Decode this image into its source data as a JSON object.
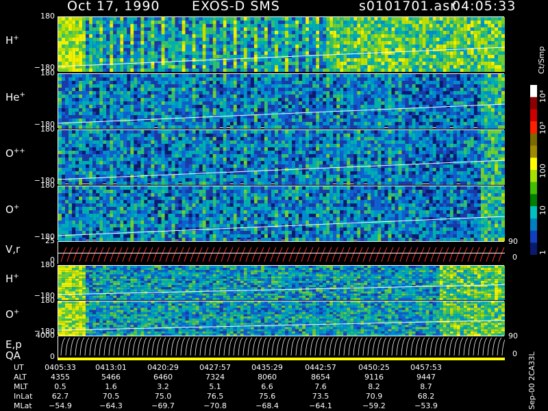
{
  "header": {
    "date": "Oct 17, 1990",
    "instrument": "EXOS-D SMS",
    "file": "s0101701.asr",
    "time": "04:05:33"
  },
  "panels": [
    {
      "id": "h-plus-1",
      "label": "H",
      "sup": "+",
      "top_tick": "180",
      "bottom_tick": "−180"
    },
    {
      "id": "he-plus",
      "label": "He",
      "sup": "+",
      "top_tick": "180",
      "bottom_tick": "−180"
    },
    {
      "id": "o-plus-plus",
      "label": "O",
      "sup": "++",
      "top_tick": "180",
      "bottom_tick": "−180"
    },
    {
      "id": "o-plus-1",
      "label": "O",
      "sup": "+",
      "top_tick": "180",
      "bottom_tick": "−180"
    },
    {
      "id": "vr",
      "label": "V,r",
      "sup": "",
      "top_tick": "25",
      "bottom_tick": "0",
      "right_top": "90",
      "right_bottom": "0"
    },
    {
      "id": "h-plus-2",
      "label": "H",
      "sup": "+",
      "top_tick": "180",
      "bottom_tick": "−180"
    },
    {
      "id": "o-plus-2",
      "label": "O",
      "sup": "+",
      "top_tick": "180",
      "bottom_tick": "−180"
    },
    {
      "id": "ep-qa",
      "label": "E,p",
      "label2": "QA",
      "sup": "",
      "top_tick": "4000",
      "bottom_tick": "0",
      "right_top": "90",
      "right_bottom": "0"
    }
  ],
  "colorbar": {
    "unit": "Ct/Smp",
    "labels": [
      "10⁴",
      "10³",
      "100",
      "10",
      "1"
    ],
    "colors": [
      "#ffffff",
      "#8b0000",
      "#cc0000",
      "#ff2000",
      "#7a6a00",
      "#a08a00",
      "#ffff00",
      "#a8e000",
      "#40c000",
      "#008000",
      "#00c0c0",
      "#0080c0",
      "#1040c0",
      "#0a1a6e"
    ]
  },
  "chart_data": {
    "type": "heatmap",
    "x_axis": {
      "label": "UT",
      "ticks": [
        "0405:33",
        "0413:01",
        "0420:29",
        "0427:57",
        "0435:29",
        "0442:57",
        "0450:25",
        "0457:53"
      ]
    },
    "rows": [
      {
        "name": "UT",
        "values": [
          "0405:33",
          "0413:01",
          "0420:29",
          "0427:57",
          "0435:29",
          "0442:57",
          "0450:25",
          "0457:53"
        ]
      },
      {
        "name": "ALT",
        "values": [
          "4355",
          "5466",
          "6460",
          "7324",
          "8060",
          "8654",
          "9116",
          "9447"
        ]
      },
      {
        "name": "MLT",
        "values": [
          "0.5",
          "1.6",
          "3.2",
          "5.1",
          "6.6",
          "7.6",
          "8.2",
          "8.7"
        ]
      },
      {
        "name": "InLat",
        "values": [
          "62.7",
          "70.5",
          "75.0",
          "76.5",
          "75.6",
          "73.5",
          "70.9",
          "68.2"
        ]
      },
      {
        "name": "MLat",
        "values": [
          "−54.9",
          "−64.3",
          "−69.7",
          "−70.8",
          "−68.4",
          "−64.1",
          "−59.2",
          "−53.9"
        ]
      }
    ],
    "y_range": [
      -180,
      180
    ],
    "color_scale": "log",
    "color_range": [
      1,
      10000
    ]
  },
  "footer": {
    "stamp": "Sep-00 2CA33L"
  }
}
